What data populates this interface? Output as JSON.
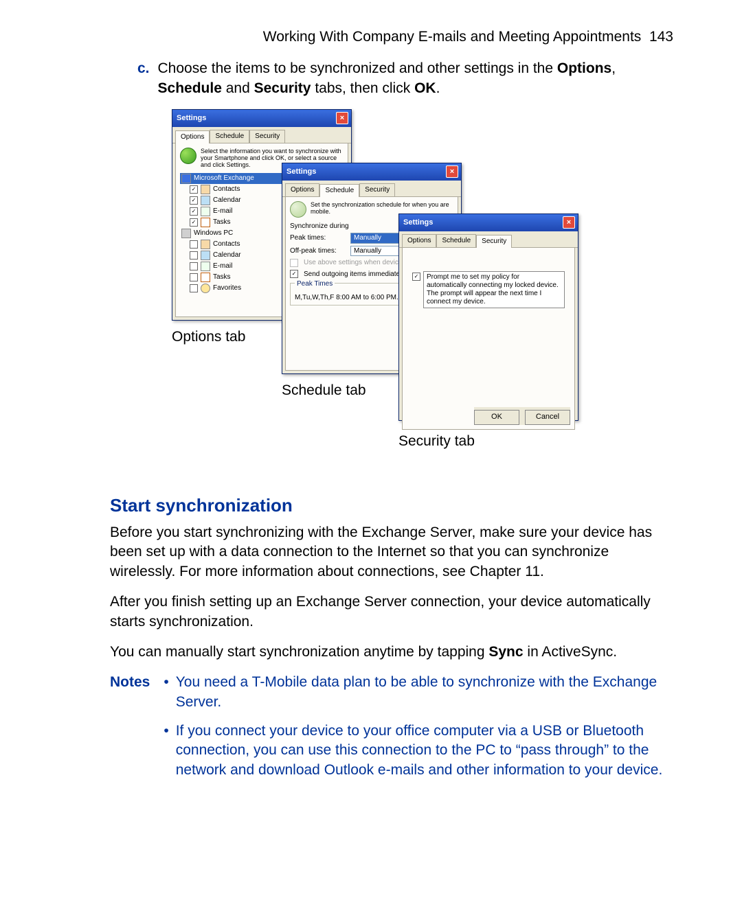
{
  "header": {
    "title": "Working With Company E-mails and Meeting Appointments",
    "page": "143"
  },
  "step": {
    "letter": "c.",
    "text_before": "Choose the items to be synchronized and other settings in the ",
    "bold1": "Options",
    "sep1": ", ",
    "bold2": "Schedule",
    "sep2": " and ",
    "bold3": "Security",
    "text_mid": " tabs, then click ",
    "bold4": "OK",
    "text_after": "."
  },
  "dlg_common": {
    "title": "Settings",
    "tab_options": "Options",
    "tab_schedule": "Schedule",
    "tab_security": "Security"
  },
  "options_dlg": {
    "info": "Select the information you want to synchronize with your Smartphone and click OK, or select a source and click Settings.",
    "group1": "Microsoft Exchange",
    "group2": "Windows PC",
    "items": {
      "contacts": "Contacts",
      "calendar": "Calendar",
      "email": "E-mail",
      "tasks": "Tasks",
      "favorites": "Favorites"
    },
    "caption": "Options tab"
  },
  "schedule_dlg": {
    "info": "Set the synchronization schedule for when you are mobile.",
    "sync_during": "Synchronize during",
    "peak_label": "Peak times:",
    "peak_value": "Manually",
    "offpeak_label": "Off-peak times:",
    "offpeak_value": "Manually",
    "roaming": "Use above settings when device is roaming",
    "send_outgoing": "Send outgoing items immediately",
    "peak_group": "Peak Times",
    "peak_text": "M,Tu,W,Th,F 8:00 AM to 6:00 PM.",
    "caption": "Schedule tab"
  },
  "security_dlg": {
    "prompt": "Prompt me to set my policy for automatically connecting my locked device. The prompt will appear the next time I connect my device.",
    "ok": "OK",
    "cancel": "Cancel",
    "caption": "Security tab"
  },
  "section_title": "Start synchronization",
  "para1": "Before you start synchronizing with the Exchange Server, make sure your device has been set up with a data connection to the Internet so that you can synchronize wirelessly. For more information about connections, see Chapter 11.",
  "para2": "After you finish setting up an Exchange Server connection, your device automatically starts synchronization.",
  "para3_before": "You can manually start synchronization anytime by tapping ",
  "para3_bold": "Sync",
  "para3_after": " in ActiveSync.",
  "notes_label": "Notes",
  "note1": "You need a T-Mobile data plan to be able to synchronize with the Exchange Server.",
  "note2": "If you connect your device to your office computer via a USB or Bluetooth connection, you can use this connection to the PC to “pass through” to the network and download Outlook e-mails and other information to your device."
}
